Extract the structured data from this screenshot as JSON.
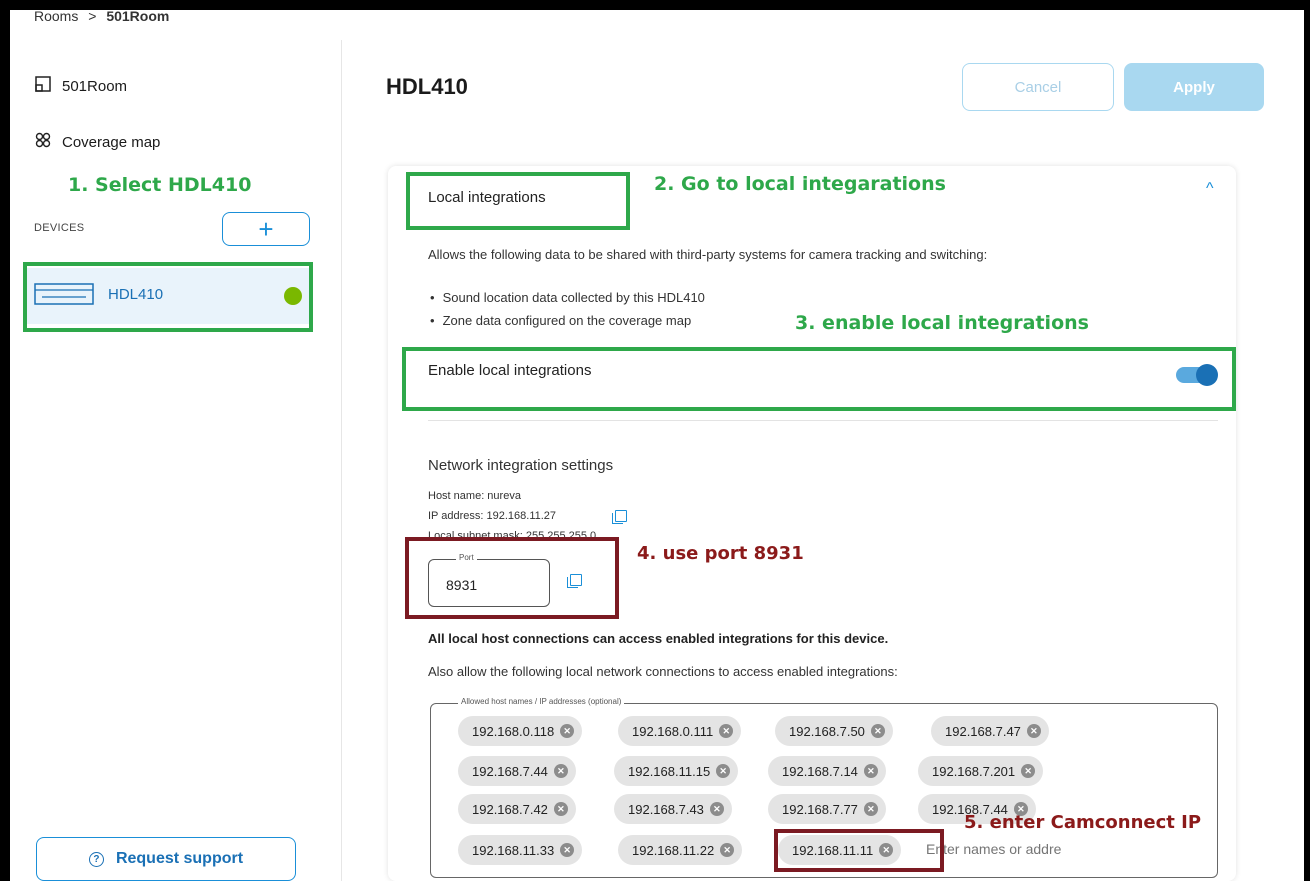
{
  "breadcrumb": {
    "root": "Rooms",
    "separator": ">",
    "current": "501Room"
  },
  "sidebar": {
    "room_label": "501Room",
    "coverage_label": "Coverage map",
    "devices_label": "DEVICES",
    "add_label": "+",
    "device": {
      "name": "HDL410",
      "status_color": "#7ab800"
    },
    "support_label": "Request support",
    "support_icon": "?"
  },
  "header": {
    "title": "HDL410",
    "cancel_label": "Cancel",
    "apply_label": "Apply"
  },
  "local_integrations": {
    "title": "Local integrations",
    "chevron": "^",
    "description": "Allows the following data to be shared with third-party systems for camera tracking and switching:",
    "bullets": [
      "Sound location data collected by this HDL410",
      "Zone data configured on the coverage map"
    ],
    "enable_label": "Enable local integrations",
    "enabled": true
  },
  "network": {
    "title": "Network integration settings",
    "host_line": "Host name:  nureva",
    "ip_line": "IP address:  192.168.11.27",
    "subnet_line": "Local subnet mask:  255.255.255.0",
    "port_legend": "Port",
    "port_value": "8931",
    "bold_note": "All local host connections can access enabled integrations for this device.",
    "also_note": "Also allow the following local network connections to access enabled integrations:",
    "hosts_legend": "Allowed host names / IP addresses (optional)",
    "hosts": [
      "192.168.0.118",
      "192.168.0.111",
      "192.168.7.50",
      "192.168.7.47",
      "192.168.7.44",
      "192.168.11.15",
      "192.168.7.14",
      "192.168.7.201",
      "192.168.7.42",
      "192.168.7.43",
      "192.168.7.77",
      "192.168.7.44",
      "192.168.11.33",
      "192.168.11.22",
      "192.168.11.11"
    ],
    "host_input_placeholder": "Enter names or addre"
  },
  "annotations": {
    "step1": "1. Select HDL410",
    "step2": "2. Go to local integarations",
    "step3": "3. enable local integrations",
    "step4": "4. use port 8931",
    "step5": "5. enter Camconnect IP",
    "green": "#2ea84a",
    "red": "#8b1a1a"
  }
}
